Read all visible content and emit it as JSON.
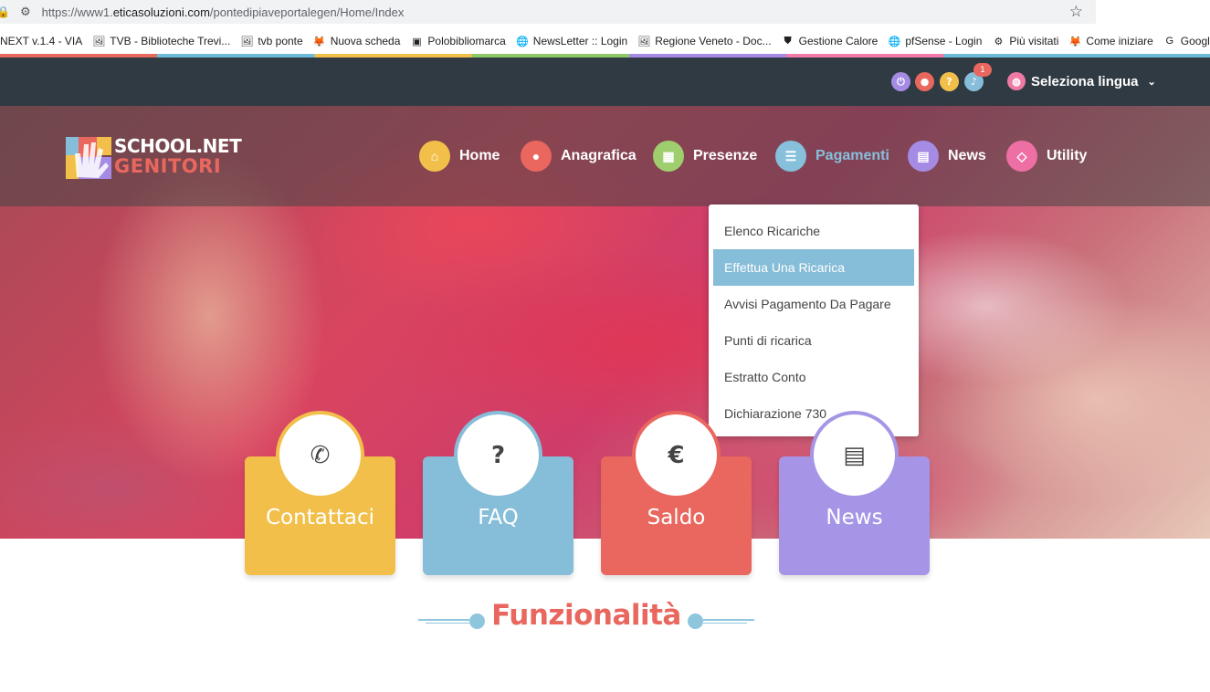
{
  "browser": {
    "url_prefix": "https://www1.",
    "url_domain": "eticasoluzioni.com",
    "url_path": "/pontedipiaveportalegen/Home/Index",
    "bookmarks": [
      {
        "label": "NEXT v.1.4 - VIA",
        "icon": ""
      },
      {
        "label": "TVB - Biblioteche Trevi...",
        "icon": "🖼"
      },
      {
        "label": "tvb ponte",
        "icon": "🖼"
      },
      {
        "label": "Nuova scheda",
        "icon": "🦊"
      },
      {
        "label": "Polobibliomarca",
        "icon": "▣"
      },
      {
        "label": "NewsLetter :: Login",
        "icon": "🌐"
      },
      {
        "label": "Regione Veneto - Doc...",
        "icon": "🖼"
      },
      {
        "label": "Gestione Calore",
        "icon": "⛊"
      },
      {
        "label": "pfSense - Login",
        "icon": "🌐"
      },
      {
        "label": "Più visitati",
        "icon": "⚙"
      },
      {
        "label": "Come iniziare",
        "icon": "🦊"
      },
      {
        "label": "Google",
        "icon": "G"
      }
    ]
  },
  "topbar": {
    "notification_count": "1",
    "language_label": "Seleziona lingua"
  },
  "logo": {
    "line1": "SCHOOL.NET",
    "line2": "GENITORI"
  },
  "nav": [
    {
      "label": "Home",
      "icon": "home-icon",
      "color": "#f2c04a",
      "glyph": "⌂"
    },
    {
      "label": "Anagrafica",
      "icon": "user-icon",
      "color": "#e9675e",
      "glyph": "●"
    },
    {
      "label": "Presenze",
      "icon": "calendar-icon",
      "color": "#9fce6e",
      "glyph": "▦"
    },
    {
      "label": "Pagamenti",
      "icon": "list-icon",
      "color": "#86c0db",
      "glyph": "☰"
    },
    {
      "label": "News",
      "icon": "newspaper-icon",
      "color": "#a68be4",
      "glyph": "▤"
    },
    {
      "label": "Utility",
      "icon": "utility-icon",
      "color": "#ee6fa4",
      "glyph": "◇"
    }
  ],
  "dropdown": [
    "Elenco Ricariche",
    "Effettua Una Ricarica",
    "Avvisi Pagamento Da Pagare",
    "Punti di ricarica",
    "Estratto Conto",
    "Dichiarazione 730"
  ],
  "cards": [
    {
      "label": "Contattaci",
      "icon": "phone-icon",
      "glyph": "✆",
      "color": "#f2c04a",
      "ring": "#f2c04a"
    },
    {
      "label": "FAQ",
      "icon": "question-icon",
      "glyph": "?",
      "color": "#86bdd8",
      "ring": "#86bdd8"
    },
    {
      "label": "Saldo",
      "icon": "euro-icon",
      "glyph": "€",
      "color": "#e9675e",
      "ring": "#e9675e"
    },
    {
      "label": "News",
      "icon": "newspaper-icon",
      "glyph": "▤",
      "color": "#a695e6",
      "ring": "#a695e6"
    }
  ],
  "section": {
    "title": "Funzionalità"
  },
  "colors": {
    "topbar": "#2f3a43",
    "accent_red": "#e9675e",
    "accent_blue": "#86bdd8"
  }
}
